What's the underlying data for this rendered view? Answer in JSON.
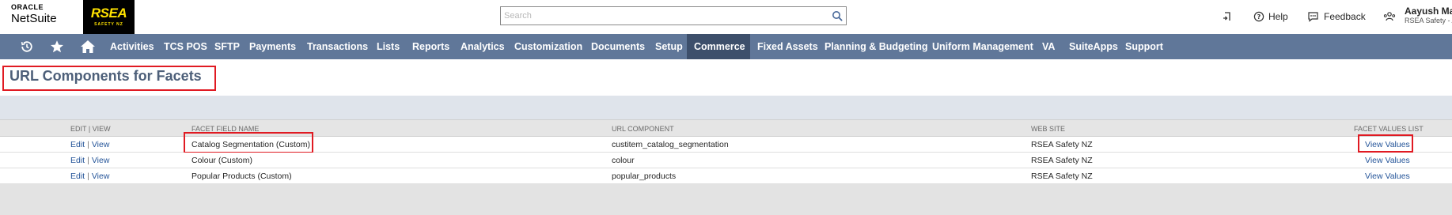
{
  "header": {
    "oracle_label": "ORACLE",
    "netsuite_label": "NetSuite",
    "brand_name": "RSEA",
    "brand_sub": "SAFETY NZ",
    "search_placeholder": "Search",
    "help_label": "Help",
    "feedback_label": "Feedback",
    "user_name": "Aayush Ma",
    "user_role": "RSEA Safety - A"
  },
  "nav": {
    "items": [
      "Activities",
      "TCS POS",
      "SFTP",
      "Payments",
      "Transactions",
      "Lists",
      "Reports",
      "Analytics",
      "Customization",
      "Documents",
      "Setup",
      "Commerce",
      "Fixed Assets",
      "Planning & Budgeting",
      "Uniform Management",
      "VA",
      "SuiteApps",
      "Support"
    ],
    "active": "Commerce"
  },
  "page": {
    "title": "URL Components for Facets"
  },
  "table": {
    "headers": [
      "EDIT | VIEW",
      "FACET FIELD NAME",
      "URL COMPONENT",
      "WEB SITE",
      "FACET VALUES LIST"
    ],
    "edit_label": "Edit",
    "view_label": "View",
    "separator": "|",
    "rows": [
      {
        "facet": "Catalog Segmentation (Custom)",
        "url": "custitem_catalog_segmentation",
        "site": "RSEA Safety NZ",
        "values": "View Values"
      },
      {
        "facet": "Colour (Custom)",
        "url": "colour",
        "site": "RSEA Safety NZ",
        "values": "View Values"
      },
      {
        "facet": "Popular Products (Custom)",
        "url": "popular_products",
        "site": "RSEA Safety NZ",
        "values": "View Values"
      }
    ]
  },
  "colors": {
    "nav_bg": "#607799",
    "nav_active_bg": "#3d4f6b",
    "title_color": "#4d5f79",
    "link_color": "#255599",
    "highlight": "#e01a22"
  }
}
